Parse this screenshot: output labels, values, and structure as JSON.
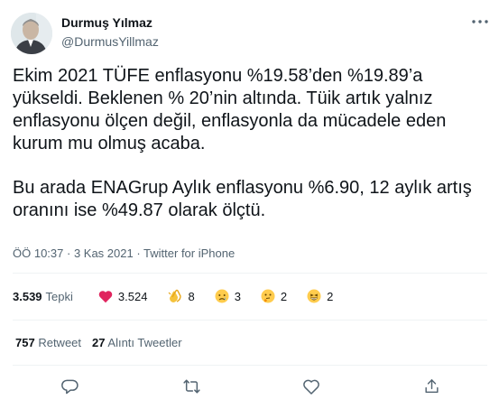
{
  "author": {
    "name": "Durmuş Yılmaz",
    "handle": "@DurmusYillmaz"
  },
  "tweet": {
    "paragraph1": "Ekim 2021 TÜFE  enflasyonu %19.58’den %19.89’a yükseldi. Beklenen % 20’nin altında. Tüik artık yalnız enflasyonu ölçen değil, enflasyonla da mücadele eden kurum mu olmuş acaba.",
    "paragraph2": "Bu arada ENAGrup Aylık enflasyonu %6.90, 12 aylık artış oranını ise %49.87 olarak ölçtü."
  },
  "meta": {
    "time": "ÖÖ 10:37",
    "sep1": " · ",
    "date": "3 Kas 2021",
    "sep2": " · ",
    "source": "Twitter for iPhone"
  },
  "reactions": {
    "total_count": "3.539",
    "total_label": "Tepki",
    "items": [
      {
        "icon": "heart-icon",
        "count": "3.524"
      },
      {
        "icon": "clapping-hands-icon",
        "count": "8"
      },
      {
        "icon": "sad-face-icon",
        "count": "3"
      },
      {
        "icon": "thinking-face-icon",
        "count": "2"
      },
      {
        "icon": "laughing-face-icon",
        "count": "2"
      }
    ]
  },
  "stats": {
    "retweet_count": "757",
    "retweet_label": "Retweet",
    "quote_count": "27",
    "quote_label": "Alıntı Tweetler"
  },
  "actions": [
    "reply-icon",
    "retweet-icon",
    "like-icon",
    "share-icon"
  ],
  "colors": {
    "text": "#0f1419",
    "secondary": "#536471",
    "divider": "#eff3f4",
    "heart": "#f91880"
  }
}
